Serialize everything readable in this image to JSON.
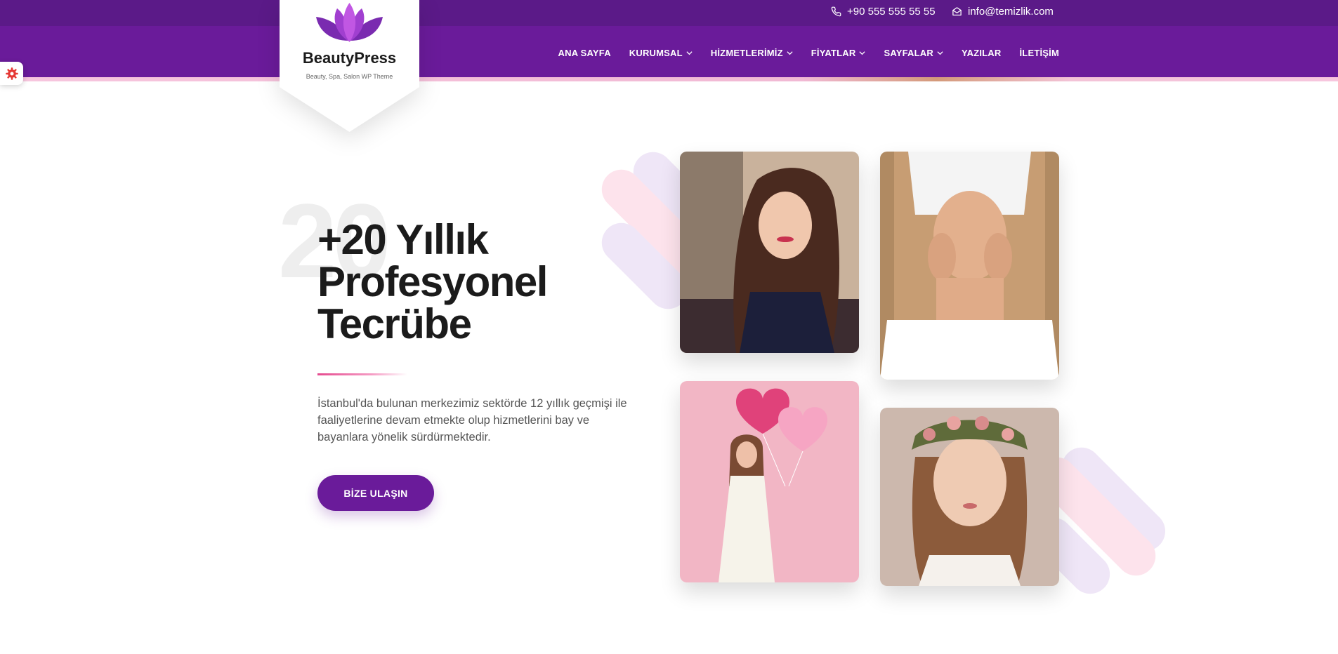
{
  "topbar": {
    "phone": "+90 555 555 55 55",
    "email": "info@temizlik.com",
    "phone_icon": "phone-icon",
    "email_icon": "envelope-icon"
  },
  "logo": {
    "title": "BeautyPress",
    "subtitle": "Beauty, Spa, Salon WP Theme",
    "icon": "lotus-icon"
  },
  "nav": {
    "items": [
      {
        "label": "ANA SAYFA",
        "dropdown": false
      },
      {
        "label": "KURUMSAL",
        "dropdown": true
      },
      {
        "label": "HİZMETLERİMİZ",
        "dropdown": true
      },
      {
        "label": "FİYATLAR",
        "dropdown": true
      },
      {
        "label": "SAYFALAR",
        "dropdown": true
      },
      {
        "label": "YAZILAR",
        "dropdown": false
      },
      {
        "label": "İLETİŞİM",
        "dropdown": false
      }
    ]
  },
  "hero": {
    "background_number": "20",
    "heading_lines": [
      "+20 Yıllık",
      "Profesyonel",
      "Tecrübe"
    ],
    "description": "İstanbul'da bulunan merkezimiz sektörde 12 yıllık geçmişi ile faaliyetlerine devam etmekte olup hizmetlerini bay ve bayanlara yönelik sürdürmektedir.",
    "button_label": "BİZE ULAŞIN"
  },
  "gallery": {
    "photos": [
      "hair-salon-woman-photo",
      "spa-face-massage-photo",
      "woman-with-heart-balloons-photo",
      "woman-flower-crown-photo"
    ]
  },
  "side_widget": {
    "icon": "gear-icon"
  },
  "colors": {
    "primary": "#6a1b9a",
    "topbar": "#5b1a88",
    "accent_pink": "#e54b8f",
    "text_dark": "#1b1b1b"
  }
}
